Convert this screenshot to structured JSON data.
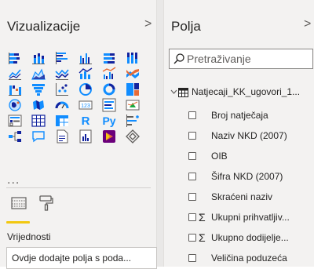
{
  "viz": {
    "title": "Vizualizacije",
    "chevron": ">",
    "more": "...",
    "icons": [
      "stacked-bar-chart-icon",
      "stacked-column-chart-icon",
      "clustered-bar-chart-icon",
      "clustered-column-chart-icon",
      "100pct-bar-chart-icon",
      "100pct-column-chart-icon",
      "line-chart-icon",
      "area-chart-icon",
      "stacked-area-chart-icon",
      "line-column-chart-icon",
      "line-clustered-column-chart-icon",
      "ribbon-chart-icon",
      "waterfall-chart-icon",
      "funnel-chart-icon",
      "scatter-chart-icon",
      "pie-chart-icon",
      "donut-chart-icon",
      "treemap-icon",
      "map-icon",
      "filled-map-icon",
      "gauge-icon",
      "card-icon",
      "multi-row-card-icon",
      "kpi-icon",
      "slicer-icon",
      "table-icon",
      "matrix-icon",
      "r-visual-icon",
      "python-visual-icon",
      "key-influencers-icon",
      "decomposition-tree-icon",
      "qa-icon",
      "smart-narrative-icon",
      "paginated-report-icon",
      "power-apps-icon",
      "diamond-icon"
    ],
    "r_label": "R",
    "py_label": "Py",
    "card_label": "123",
    "section_label": "Vrijednosti",
    "drop_placeholder": "Ovdje dodajte polja s poda..."
  },
  "fields": {
    "title": "Polja",
    "chevron": ">",
    "search_placeholder": "Pretraživanje",
    "table_name": "Natjecaji_KK_ugovori_1...",
    "items": [
      {
        "label": "Broj natječaja",
        "sigma": false
      },
      {
        "label": "Naziv NKD (2007)",
        "sigma": false
      },
      {
        "label": "OIB",
        "sigma": false
      },
      {
        "label": "Šifra NKD (2007)",
        "sigma": false
      },
      {
        "label": "Skraćeni naziv",
        "sigma": false
      },
      {
        "label": "Ukupni prihvatljiv...",
        "sigma": true
      },
      {
        "label": "Ukupno dodijelje...",
        "sigma": true
      },
      {
        "label": "Veličina poduzeća",
        "sigma": false
      }
    ]
  },
  "colors": {
    "accent": "#f2c811",
    "chart_blue": "#118dff",
    "chart_navy": "#12239e",
    "chart_orange": "#e66c37",
    "chart_purple": "#6b007b",
    "icon_gray": "#605e5c"
  }
}
